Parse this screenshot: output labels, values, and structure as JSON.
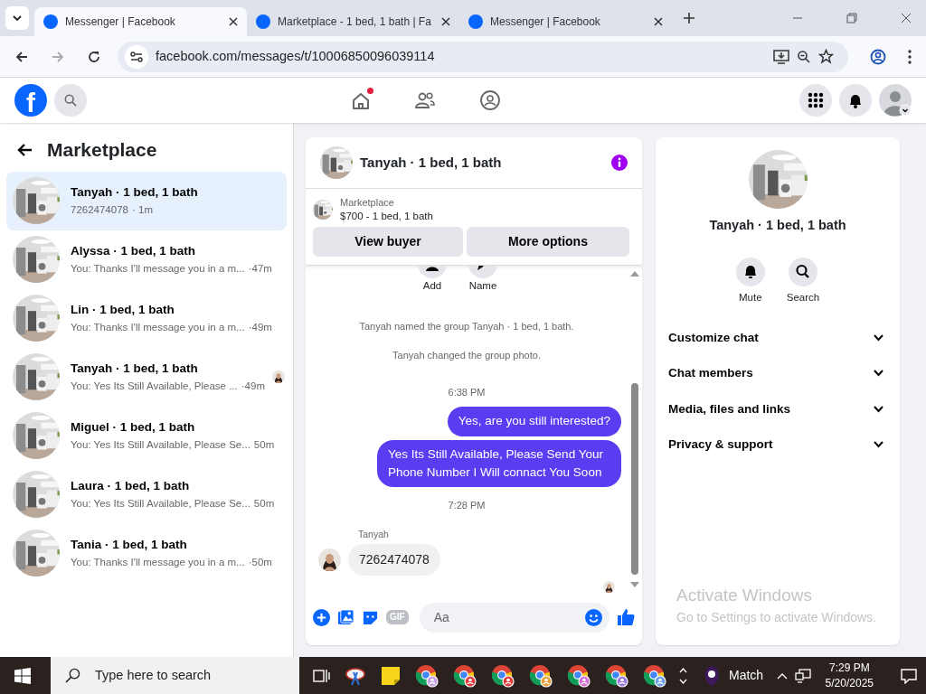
{
  "browser": {
    "tabs": [
      {
        "title": "Messenger | Facebook",
        "selected": true
      },
      {
        "title": "Marketplace - 1 bed, 1 bath | Fa",
        "selected": false
      },
      {
        "title": "Messenger | Facebook",
        "selected": false
      }
    ],
    "url": "facebook.com/messages/t/10006850096039114"
  },
  "header": {
    "logo": "f",
    "home_notification": true
  },
  "sidebar": {
    "title": "Marketplace",
    "conversations": [
      {
        "name": "Tanyah · 1 bed, 1 bath",
        "preview": "7262474078",
        "time": "· 1m",
        "selected": true,
        "seen": false
      },
      {
        "name": "Alyssa · 1 bed, 1 bath",
        "preview": "You: Thanks I'll message you in a m...",
        "time": "·47m",
        "selected": false,
        "seen": false
      },
      {
        "name": "Lin · 1 bed, 1 bath",
        "preview": "You: Thanks I'll message you in a m...",
        "time": "·49m",
        "selected": false,
        "seen": false
      },
      {
        "name": "Tanyah · 1 bed, 1 bath",
        "preview": "You: Yes Its Still Available, Please ...",
        "time": "·49m",
        "selected": false,
        "seen": true
      },
      {
        "name": "Miguel · 1 bed, 1 bath",
        "preview": "You: Yes Its Still Available, Please Se...",
        "time": "50m",
        "selected": false,
        "seen": false
      },
      {
        "name": "Laura · 1 bed, 1 bath",
        "preview": "You: Yes Its Still Available, Please Se...",
        "time": "50m",
        "selected": false,
        "seen": false
      },
      {
        "name": "Tania · 1 bed, 1 bath",
        "preview": "You: Thanks I'll message you in a m...",
        "time": "·50m",
        "selected": false,
        "seen": false
      }
    ]
  },
  "chat": {
    "title": "Tanyah · 1 bed, 1 bath",
    "listing": {
      "source": "Marketplace",
      "title": "$700 - 1 bed, 1 bath"
    },
    "buttons": [
      "View buyer",
      "More options"
    ],
    "group_actions": [
      {
        "label": "Add",
        "kind": "add"
      },
      {
        "label": "Name",
        "kind": "name"
      }
    ],
    "thread": [
      {
        "kind": "system",
        "text": "Tanyah named the group Tanyah · 1 bed, 1 bath."
      },
      {
        "kind": "system",
        "text": "Tanyah changed the group photo."
      },
      {
        "kind": "time",
        "text": "6:38 PM"
      },
      {
        "kind": "outgoing",
        "text": "Yes, are you still interested?"
      },
      {
        "kind": "outgoing",
        "text": "Yes Its Still Available, Please Send Your Phone Number I Will connact You Soon"
      },
      {
        "kind": "time",
        "text": "7:28 PM"
      },
      {
        "kind": "incoming",
        "sender": "Tanyah",
        "text": "7262474078"
      }
    ],
    "read_receipt": true,
    "composer": {
      "placeholder": "Aa",
      "gif_label": "GIF"
    }
  },
  "info": {
    "name": "Tanyah · 1 bed, 1 bath",
    "actions": [
      {
        "label": "Mute",
        "kind": "mute"
      },
      {
        "label": "Search",
        "kind": "search"
      }
    ],
    "sections": [
      {
        "label": "Customize chat",
        "expanded": false
      },
      {
        "label": "Chat members",
        "expanded": false
      },
      {
        "label": "Media, files and links",
        "expanded": false
      },
      {
        "label": "Privacy & support",
        "expanded": false
      }
    ]
  },
  "os_notice": {
    "title": "Activate Windows",
    "subtitle": "Go to Settings to activate Windows."
  },
  "taskbar": {
    "search_placeholder": "Type here to search",
    "widget": "Match",
    "time": "7:29 PM",
    "date": "5/20/2025"
  }
}
